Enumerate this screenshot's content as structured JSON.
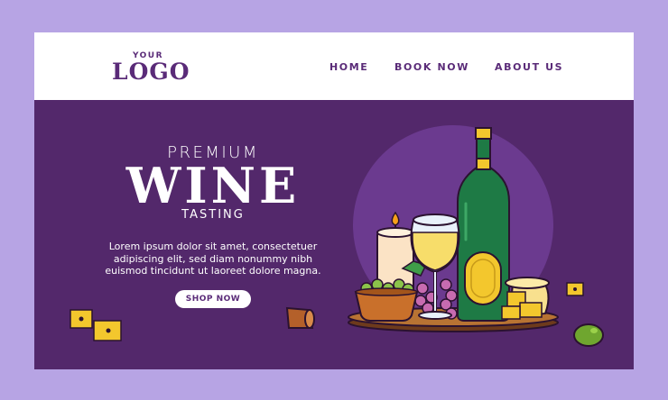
{
  "header": {
    "logo_small": "YOUR",
    "logo_big": "LOGO",
    "nav": [
      "HOME",
      "BOOK NOW",
      "ABOUT US"
    ]
  },
  "hero": {
    "line1": "PREMIUM",
    "line2": "WINE",
    "line3": "TASTING",
    "description_lines": [
      "Lorem ipsum dolor sit amet, consectetuer",
      "adipiscing elit, sed diam nonummy nibh",
      "euismod tincidunt ut laoreet dolore magna."
    ],
    "cta": "SHOP NOW"
  },
  "colors": {
    "page_background": "#b7a4e4",
    "hero_background": "#53286b",
    "accent_purple": "#5a2b78",
    "bottle_green": "#1e7a45",
    "wine_yellow": "#f7dd6a"
  },
  "illustration": {
    "items": [
      "candle-icon",
      "wine-glass-icon",
      "wine-bottle-icon",
      "grapes-icon",
      "olive-bowl-icon",
      "cheese-icon",
      "cork-icon",
      "olive-icon"
    ]
  }
}
